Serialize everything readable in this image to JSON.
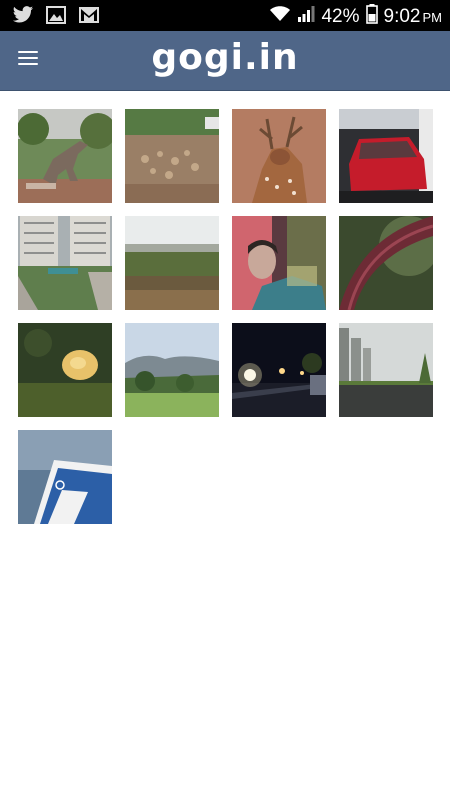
{
  "status_bar": {
    "left_icons": [
      "twitter-icon",
      "gallery-icon",
      "gmail-icon"
    ],
    "battery_percent": "42%",
    "time": "9:02",
    "ampm": "PM"
  },
  "app_bar": {
    "title": "gogi.in",
    "background": "#4f6688",
    "menu_icon": "hamburger-menu-icon"
  },
  "gallery": {
    "photos": [
      {
        "subject": "dinosaur statue"
      },
      {
        "subject": "herd of deer"
      },
      {
        "subject": "spotted deer"
      },
      {
        "subject": "red car in parking"
      },
      {
        "subject": "apartment buildings"
      },
      {
        "subject": "misty field"
      },
      {
        "subject": "person portrait"
      },
      {
        "subject": "leaf closeup"
      },
      {
        "subject": "yellow flower"
      },
      {
        "subject": "hills landscape"
      },
      {
        "subject": "night street"
      },
      {
        "subject": "towers and road"
      },
      {
        "subject": "skip card"
      }
    ]
  }
}
